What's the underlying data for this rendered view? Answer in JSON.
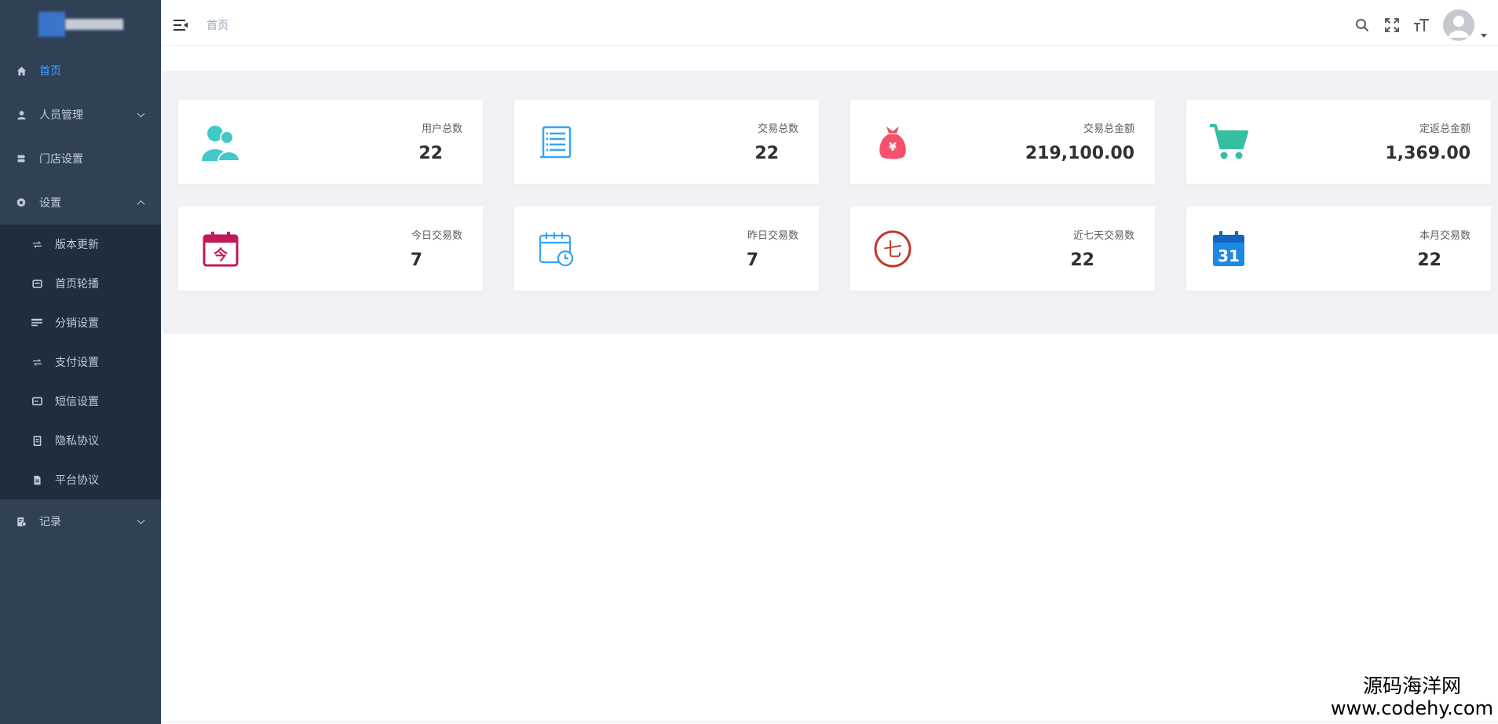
{
  "sidebar": {
    "items": [
      {
        "label": "首页",
        "icon": "home-icon",
        "active": true
      },
      {
        "label": "人员管理",
        "icon": "user-icon",
        "expandable": true
      },
      {
        "label": "门店设置",
        "icon": "store-icon"
      },
      {
        "label": "设置",
        "icon": "gear-icon",
        "expanded": true
      }
    ],
    "settings_sub": [
      {
        "label": "版本更新",
        "icon": "transfer-icon"
      },
      {
        "label": "首页轮播",
        "icon": "carousel-icon"
      },
      {
        "label": "分销设置",
        "icon": "card-icon"
      },
      {
        "label": "支付设置",
        "icon": "transfer-icon"
      },
      {
        "label": "短信设置",
        "icon": "message-icon"
      },
      {
        "label": "隐私协议",
        "icon": "document-icon"
      },
      {
        "label": "平台协议",
        "icon": "file-icon"
      }
    ],
    "record": {
      "label": "记录",
      "icon": "record-icon",
      "expandable": true
    }
  },
  "header": {
    "breadcrumb": "首页",
    "tools": [
      "search-icon",
      "fullscreen-icon",
      "font-size-icon"
    ],
    "avatar": "avatar-icon"
  },
  "stats": [
    {
      "title": "用户总数",
      "value": "22",
      "icon": "users-icon",
      "color": "#40c9c6"
    },
    {
      "title": "交易总数",
      "value": "22",
      "icon": "list-scroll-icon",
      "color": "#36a3f7"
    },
    {
      "title": "交易总金额",
      "value": "219,100.00",
      "icon": "money-bag-icon",
      "color": "#f4516c"
    },
    {
      "title": "定返总金额",
      "value": "1,369.00",
      "icon": "cart-icon",
      "color": "#34bfa3"
    },
    {
      "title": "今日交易数",
      "value": "7",
      "icon": "today-calendar-icon",
      "color": "#c2185b"
    },
    {
      "title": "昨日交易数",
      "value": "7",
      "icon": "calendar-clock-icon",
      "color": "#36a3f7"
    },
    {
      "title": "近七天交易数",
      "value": "22",
      "icon": "seven-circle-icon",
      "color": "#c0392b"
    },
    {
      "title": "本月交易数",
      "value": "22",
      "icon": "calendar-31-icon",
      "color": "#1e88e5"
    }
  ],
  "icon_text": {
    "today": "今",
    "seven": "七",
    "month": "31",
    "yen": "¥"
  },
  "watermark": {
    "cn": "源码海洋网",
    "en": "www.codehy.com"
  },
  "colors": {
    "sidebar_bg": "#304156",
    "submenu_bg": "#1f2d3d",
    "active": "#409eff",
    "panel_bg": "#f0f2f5"
  }
}
